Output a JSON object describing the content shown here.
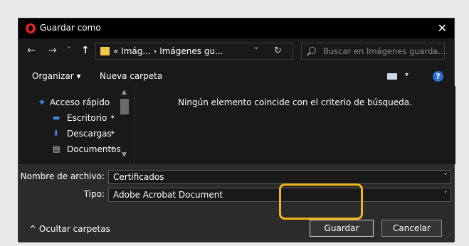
{
  "window": {
    "title": "Guardar como",
    "close_glyph": "✕"
  },
  "nav": {
    "back_glyph": "←",
    "forward_glyph": "→",
    "recent_glyph": "˅",
    "up_glyph": "↑",
    "breadcrumb": "« Imág... › Imágenes gu...",
    "dropdown_glyph": "˅",
    "refresh_glyph": "↻",
    "search_placeholder": "Buscar en Imágenes guarda..."
  },
  "toolbar": {
    "organize_label": "Organizar ▾",
    "new_folder_label": "Nueva carpeta",
    "view_dropdown_glyph": "▾",
    "help_glyph": "?"
  },
  "sidebar": {
    "items": [
      {
        "label": "Acceso rápido",
        "icon": "star-icon",
        "glyph": "★",
        "color": "#3b8ee8"
      },
      {
        "label": "Escritorio",
        "icon": "desktop-icon",
        "glyph": "▬",
        "color": "#3b8ee8",
        "pin": "📌"
      },
      {
        "label": "Descargas",
        "icon": "download-icon",
        "glyph": "⬇",
        "color": "#3b8ee8",
        "pin": "📌"
      },
      {
        "label": "Documentos",
        "icon": "document-icon",
        "glyph": "▤",
        "color": "#d8d8d8",
        "pin": "📌"
      }
    ]
  },
  "content": {
    "empty_message": "Ningún elemento coincide con el criterio de búsqueda."
  },
  "form": {
    "filename_label": "Nombre de archivo:",
    "filename_value": "Certificados",
    "type_label": "Tipo:",
    "type_value": "Adobe Acrobat Document",
    "dropdown_glyph": "˅"
  },
  "footer": {
    "hide_folders_label": "^  Ocultar carpetas",
    "save_label": "Guardar",
    "cancel_label": "Cancelar"
  },
  "colors": {
    "highlight": "#f0b51a",
    "accent": "#2a6fd6",
    "background": "#191919"
  }
}
